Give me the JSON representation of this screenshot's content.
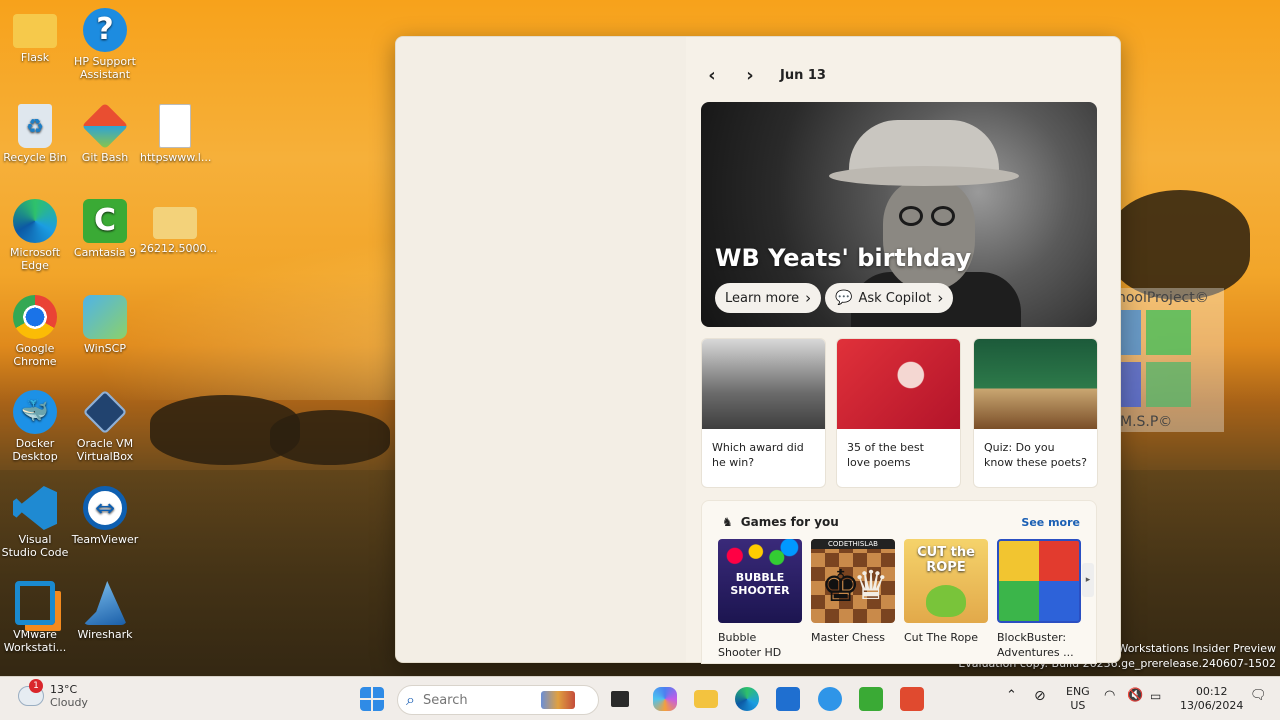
{
  "desktop": {
    "icons": [
      {
        "label": "Flask",
        "icon": "folder-icon"
      },
      {
        "label": "HP Support Assistant",
        "icon": "help-icon"
      },
      {
        "label": "Recycle Bin",
        "icon": "recycle-bin-icon"
      },
      {
        "label": "Git Bash",
        "icon": "git-icon"
      },
      {
        "label": "httpswww.l...",
        "icon": "document-icon"
      },
      {
        "label": "Microsoft Edge",
        "icon": "edge-icon"
      },
      {
        "label": "Camtasia 9",
        "icon": "camtasia-icon"
      },
      {
        "label": "26212.5000...",
        "icon": "folder-icon"
      },
      {
        "label": "Google Chrome",
        "icon": "chrome-icon"
      },
      {
        "label": "WinSCP",
        "icon": "winscp-icon"
      },
      {
        "label": "Docker Desktop",
        "icon": "docker-icon"
      },
      {
        "label": "Oracle VM VirtualBox",
        "icon": "virtualbox-icon"
      },
      {
        "label": "Visual Studio Code",
        "icon": "vscode-icon"
      },
      {
        "label": "TeamViewer",
        "icon": "teamviewer-icon"
      },
      {
        "label": "VMware Workstati...",
        "icon": "vmware-icon"
      },
      {
        "label": "Wireshark",
        "icon": "wireshark-icon"
      }
    ],
    "eval_line1": "or Workstations Insider Preview",
    "eval_line2": "Evaluation copy. Build 26236.ge_prerelease.240607-1502",
    "watermark_top": "MySchoolProject©",
    "watermark_bottom": "M.S.P©"
  },
  "widgets": {
    "date": "Jun 13",
    "hero": {
      "title": "WB Yeats' birthday",
      "learn_more": "Learn more",
      "ask_copilot": "Ask Copilot"
    },
    "cards": [
      {
        "text": "Which award did he win?"
      },
      {
        "text": "35 of the best love poems"
      },
      {
        "text": "Quiz: Do you know these poets?"
      }
    ],
    "games": {
      "title": "Games for you",
      "see_more": "See more",
      "items": [
        {
          "label": "Bubble Shooter HD",
          "art": "BUBBLE SHOOTER"
        },
        {
          "label": "Master Chess",
          "art": "CODETHISLAB"
        },
        {
          "label": "Cut The Rope",
          "art": "CUT the ROPE"
        },
        {
          "label": "BlockBuster: Adventures ...",
          "art": ""
        }
      ]
    }
  },
  "taskbar": {
    "weather_badge": "1",
    "temperature": "13°C",
    "condition": "Cloudy",
    "search_placeholder": "Search",
    "language": "ENG",
    "region": "US",
    "time": "00:12",
    "date": "13/06/2024"
  }
}
